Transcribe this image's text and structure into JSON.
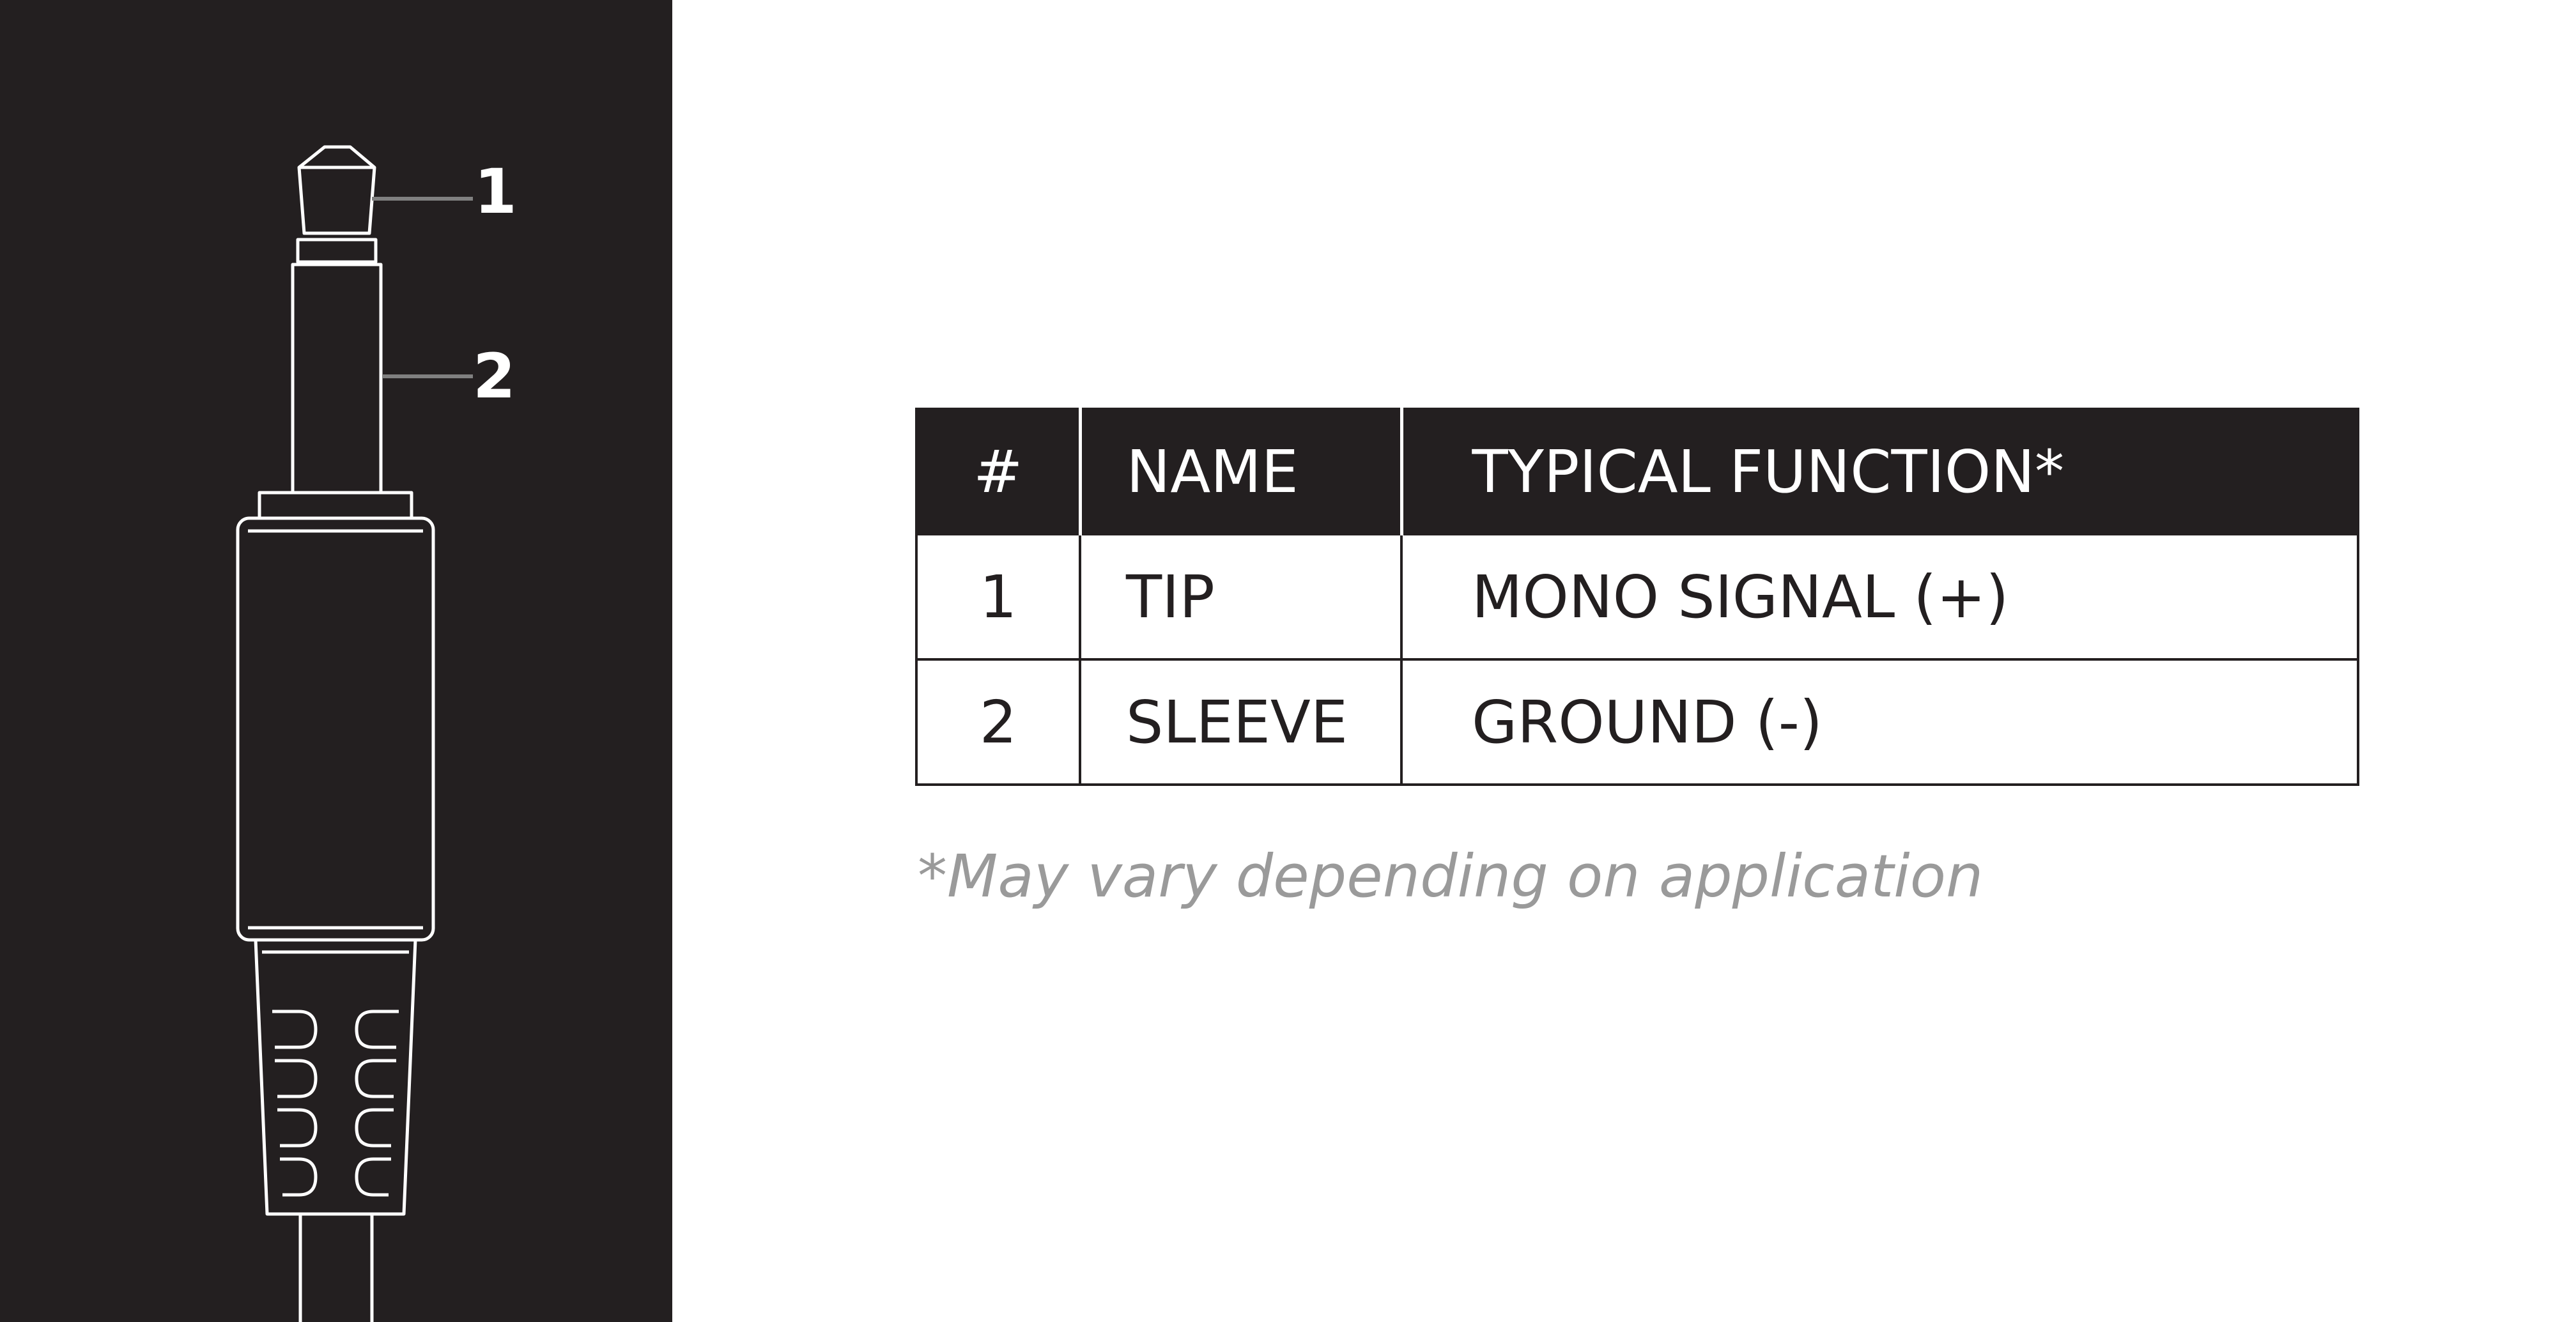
{
  "colors": {
    "panel_background": "#231f20",
    "line_art": "#ffffff",
    "leader_line": "#808080",
    "table_header_background": "#231f20",
    "table_border": "#231f20",
    "footnote_text": "#9a9a9a"
  },
  "diagram": {
    "callouts": [
      {
        "number": "1"
      },
      {
        "number": "2"
      }
    ]
  },
  "table": {
    "headers": [
      "#",
      "NAME",
      "TYPICAL FUNCTION*"
    ],
    "rows": [
      {
        "number": "1",
        "name": "TIP",
        "function": "MONO SIGNAL (+)"
      },
      {
        "number": "2",
        "name": "SLEEVE",
        "function": "GROUND (-)"
      }
    ]
  },
  "footnote": "*May vary depending on application"
}
